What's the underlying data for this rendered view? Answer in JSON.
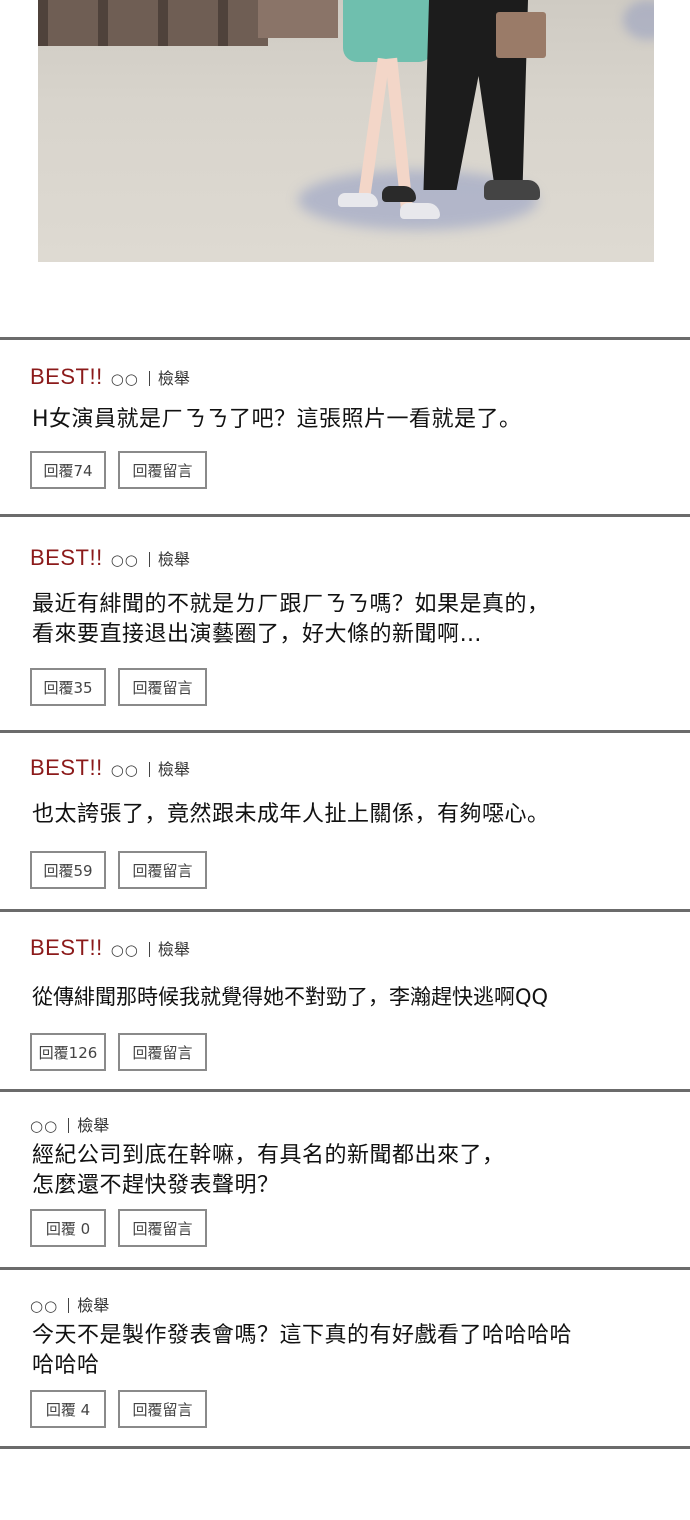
{
  "best_label": "BEST!!",
  "user_label": "○○",
  "report_label": "檢舉",
  "leave_reply_label": "回覆留言",
  "comments": [
    {
      "best": true,
      "lines": [
        "H女演員就是ㄏㄋㄋ了吧？這張照片一看就是了。"
      ],
      "reply_label": "回覆74"
    },
    {
      "best": true,
      "lines": [
        "最近有緋聞的不就是ㄌㄏ跟ㄏㄋㄋ嗎？如果是真的，",
        "看來要直接退出演藝圈了，好大條的新聞啊…"
      ],
      "reply_label": "回覆35"
    },
    {
      "best": true,
      "lines": [
        "也太誇張了，竟然跟未成年人扯上關係，有夠噁心。"
      ],
      "reply_label": "回覆59"
    },
    {
      "best": true,
      "lines": [
        "從傳緋聞那時候我就覺得她不對勁了，李瀚趕快逃啊QQ"
      ],
      "reply_label": "回覆126"
    },
    {
      "best": false,
      "lines": [
        "經紀公司到底在幹嘛，有具名的新聞都出來了，",
        "怎麼還不趕快發表聲明？"
      ],
      "reply_label": "回覆 0"
    },
    {
      "best": false,
      "lines": [
        "今天不是製作發表會嗎？這下真的有好戲看了哈哈哈哈",
        "哈哈哈"
      ],
      "reply_label": "回覆 4"
    }
  ]
}
